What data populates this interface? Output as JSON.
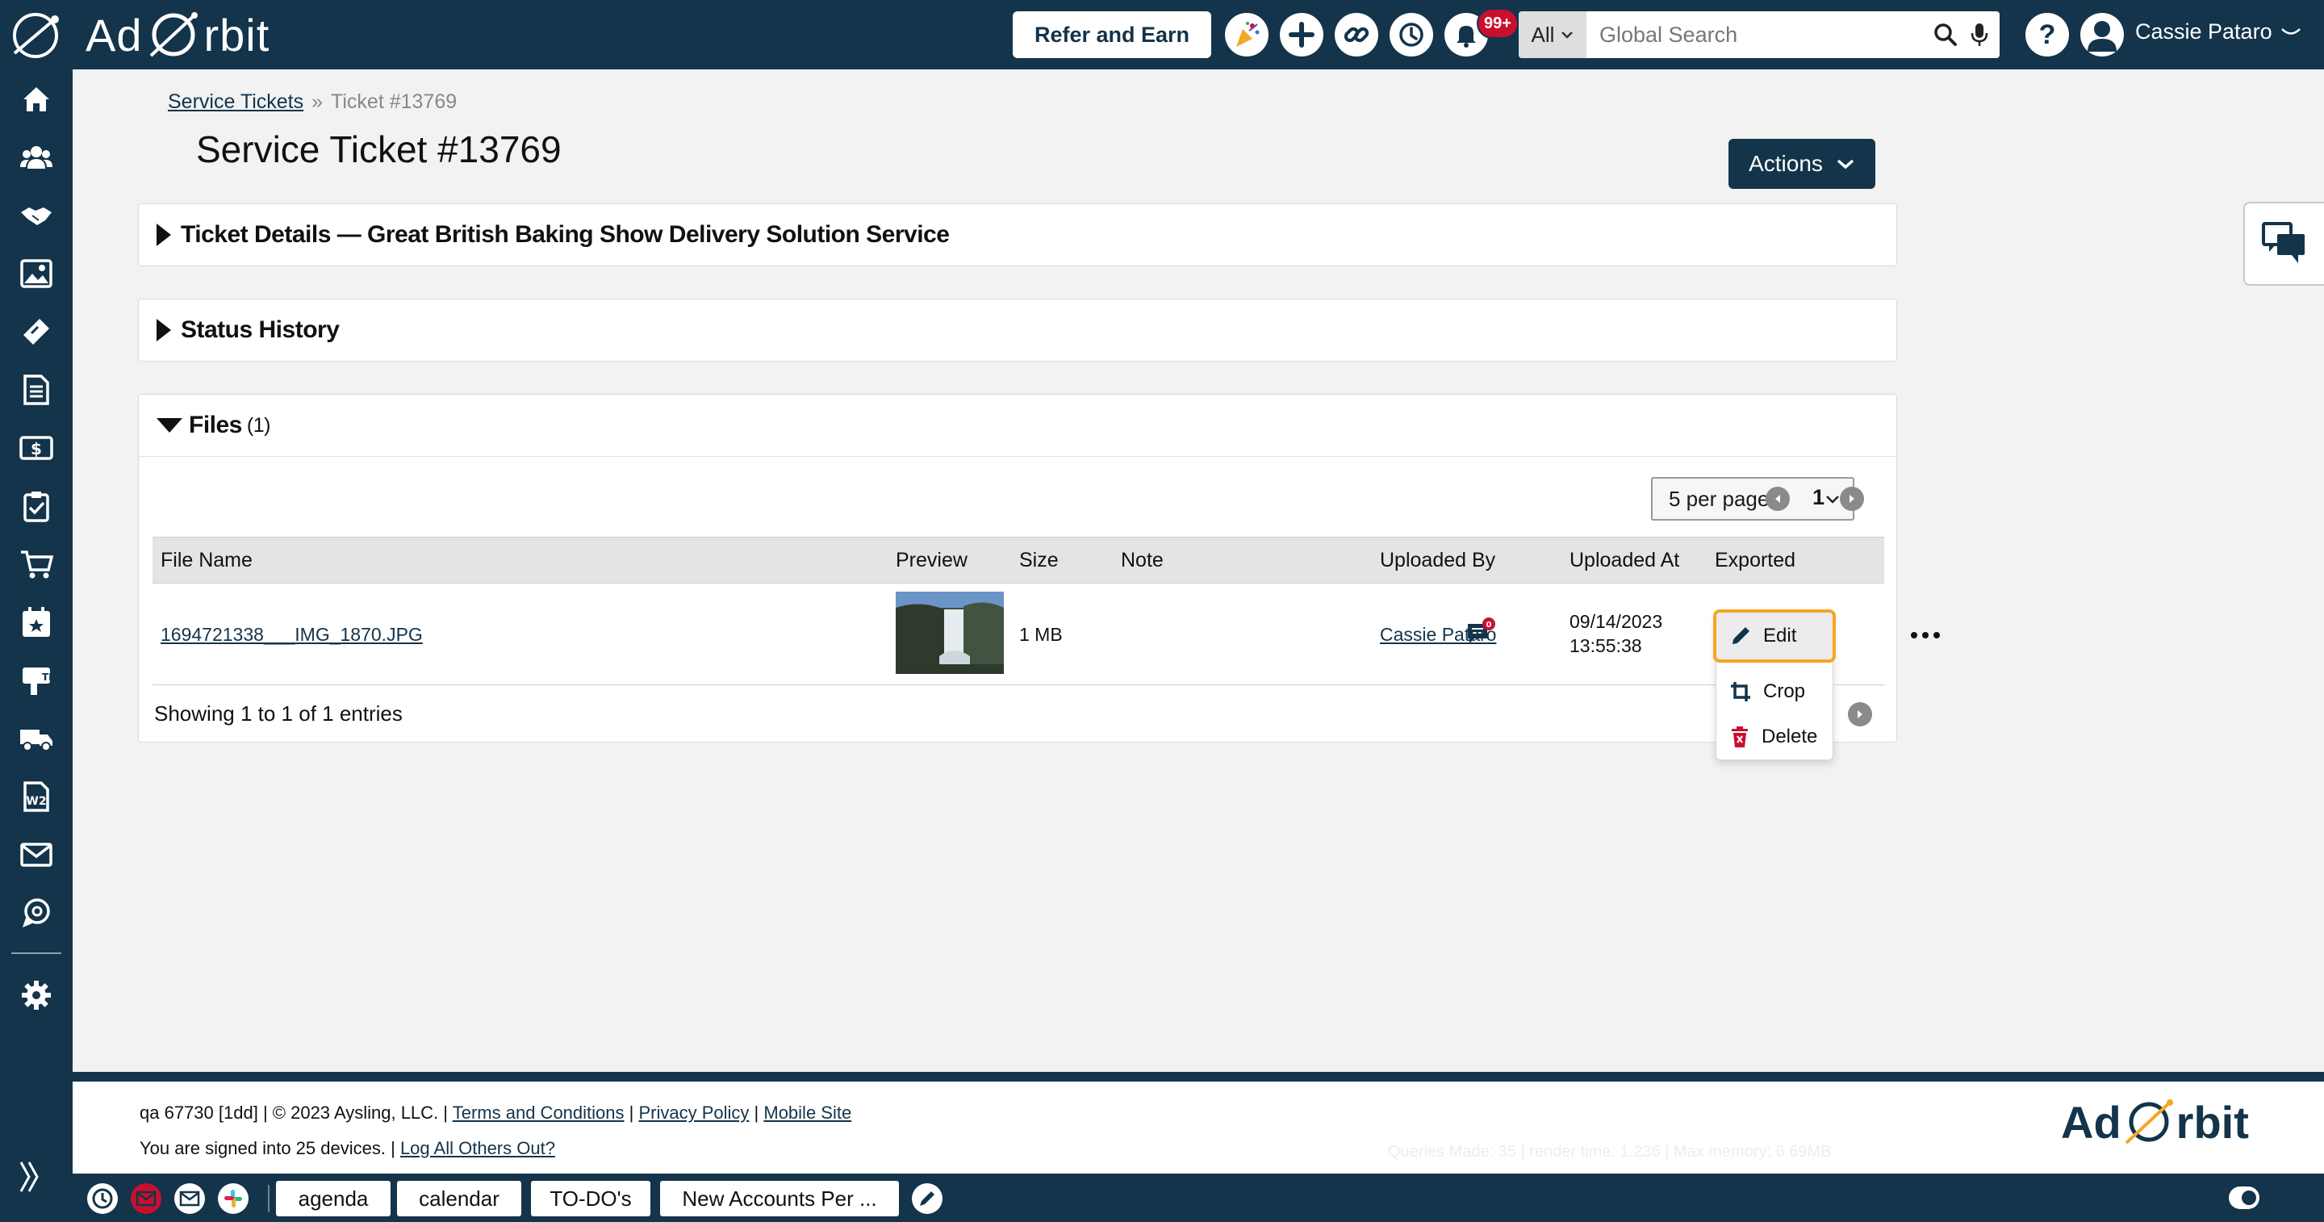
{
  "app": {
    "brand_left": "Ad",
    "brand_right": "rbit",
    "refer_label": "Refer and Earn",
    "notifications_badge": "99+",
    "search": {
      "scope": "All",
      "placeholder": "Global Search"
    },
    "help_label": "?",
    "user_name": "Cassie Pataro"
  },
  "breadcrumb": {
    "parent": "Service Tickets",
    "separator": "»",
    "current": "Ticket #13769"
  },
  "page_title": "Service Ticket #13769",
  "actions_label": "Actions",
  "sections": {
    "ticket_details": "Ticket Details — Great British Baking Show Delivery Solution Service",
    "status_history": "Status History",
    "files": "Files",
    "files_count": "(1)"
  },
  "files": {
    "per_page": "5 per page",
    "page": "1",
    "columns": [
      "File Name",
      "Preview",
      "Size",
      "Note",
      "Uploaded By",
      "Uploaded At",
      "Exported"
    ],
    "rows": [
      {
        "file_name": "1694721338___IMG_1870.JPG",
        "size": "1 MB",
        "note_badge": "0",
        "uploaded_by": "Cassie Pataro",
        "uploaded_at_date": "09/14/2023",
        "uploaded_at_time": "13:55:38"
      }
    ],
    "showing": "Showing 1 to 1 of 1 entries",
    "row_menu": {
      "edit": "Edit",
      "crop": "Crop",
      "delete": "Delete"
    }
  },
  "footer": {
    "build": "qa 67730 [1dd]",
    "copyright": "© 2023 Aysling, LLC.",
    "sep": "|",
    "terms": "Terms and Conditions",
    "privacy": "Privacy Policy",
    "mobile": "Mobile Site",
    "signed_in": "You are signed into 25 devices.",
    "logout_others": "Log All Others Out?",
    "query_stats": "Queries Made: 35 | render time: 1.236 | Max memory: 6.69MB",
    "logo_left": "Ad",
    "logo_right": "rbit"
  },
  "bottom_tabs": [
    "agenda",
    "calendar",
    "TO-DO's",
    "New Accounts Per ..."
  ],
  "colors": {
    "navy": "#13344a",
    "accent": "#f5a623",
    "danger": "#c8102e"
  }
}
